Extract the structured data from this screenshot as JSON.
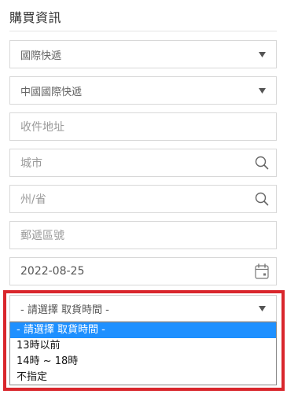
{
  "section": {
    "title": "購買資訊"
  },
  "shipping_method": {
    "value": "國際快遞"
  },
  "carrier": {
    "value": "中國國際快遞"
  },
  "address": {
    "placeholder": "收件地址"
  },
  "city": {
    "placeholder": "城市"
  },
  "state": {
    "placeholder": "州/省"
  },
  "postal_code": {
    "placeholder": "郵遞區號"
  },
  "pickup_date": {
    "value": "2022-08-25"
  },
  "pickup_time": {
    "selected": "- 請選擇 取貨時間 -",
    "options": [
      "- 請選擇 取貨時間 -",
      "13時以前",
      "14時 ~ 18時",
      "不指定"
    ]
  },
  "colors": {
    "highlight_border": "#d9262c",
    "selected_option_bg": "#1e90ff",
    "field_border": "#d8d8d8"
  },
  "icons": {
    "select_caret": "caret-down-icon",
    "search": "search-icon",
    "calendar": "calendar-icon"
  }
}
